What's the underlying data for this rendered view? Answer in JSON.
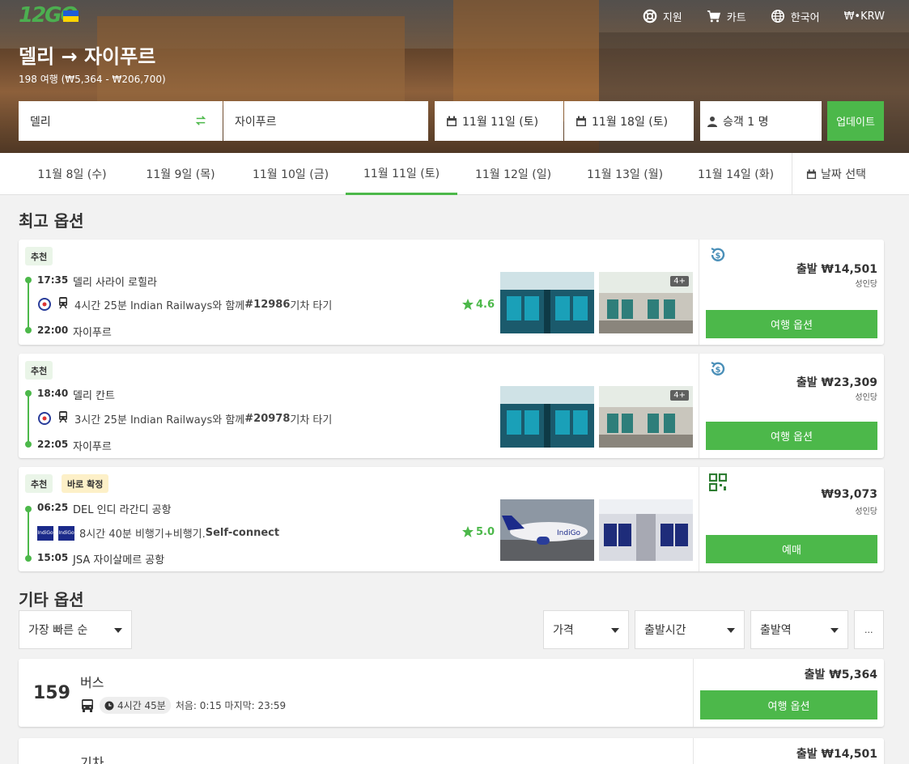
{
  "header": {
    "logo_text": "12GO",
    "route_title": "델리 → 자이푸르",
    "route_sub": "198 여행 (₩5,364 - ₩206,700)",
    "nav": [
      {
        "label": "지원",
        "icon": "lifebuoy-icon"
      },
      {
        "label": "카트",
        "icon": "cart-icon"
      },
      {
        "label": "한국어",
        "icon": "globe-icon"
      },
      {
        "label": "₩•KRW",
        "icon": ""
      }
    ]
  },
  "search": {
    "from": "델리",
    "to": "자이푸르",
    "depart_date": "11월 11일 (토)",
    "return_date": "11월 18일 (토)",
    "passengers": "승객 1 명",
    "update_label": "업데이트"
  },
  "date_tabs": [
    "11월 8일 (수)",
    "11월 9일 (목)",
    "11월 10일 (금)",
    "11월 11일 (토)",
    "11월 12일 (일)",
    "11월 13일 (월)",
    "11월 14일 (화)"
  ],
  "active_date_index": 3,
  "pick_date_label": "날짜 선택",
  "best_title": "최고 옵션",
  "best": [
    {
      "badges": [
        "추천"
      ],
      "dep_time": "17:35",
      "dep_place": "델리 사라이 로힐라",
      "segment_text": "4시간 25분 Indian Railways와 함께 ",
      "segment_bold": "#12986",
      "segment_tail": " 기차 타기",
      "arr_time": "22:00",
      "arr_place": "자이푸르",
      "rating": "4.6",
      "photo_more": "4+",
      "price": "출발 ₩14,501",
      "per": "성인당",
      "button": "여행 옵션"
    },
    {
      "badges": [
        "추천"
      ],
      "dep_time": "18:40",
      "dep_place": "델리 칸트",
      "segment_text": "3시간 25분 Indian Railways와 함께 ",
      "segment_bold": "#20978",
      "segment_tail": " 기차 타기",
      "arr_time": "22:05",
      "arr_place": "자이푸르",
      "rating": "",
      "photo_more": "4+",
      "price": "출발 ₩23,309",
      "per": "성인당",
      "button": "여행 옵션"
    },
    {
      "badges": [
        "추천",
        "바로 확정"
      ],
      "dep_time": "06:25",
      "dep_place": "DEL 인디 라간디 공항",
      "segment_text": "8시간 40분 비행기+비행기. ",
      "segment_bold": "Self-connect",
      "segment_tail": "",
      "arr_time": "15:05",
      "arr_place": "JSA 자이살메르 공항",
      "rating": "5.0",
      "photo_more": "",
      "price": "₩93,073",
      "per": "성인당",
      "button": "예매"
    }
  ],
  "other_title": "기타 옵션",
  "filters": {
    "sort": "가장 빠른 순",
    "price": "가격",
    "depart_time": "출발시간",
    "depart_station": "출발역",
    "more": "..."
  },
  "others": [
    {
      "count": "159",
      "title": "버스",
      "duration": "4시간 45분",
      "times": "처음: 0:15 마지막: 23:59",
      "price": "출발 ₩5,364",
      "button": "여행 옵션"
    },
    {
      "count": "",
      "title": "기차",
      "price": "출발 ₩14,501"
    }
  ],
  "colors": {
    "accent": "#4cb84a",
    "text": "#333333",
    "background": "#f2f2f2"
  }
}
